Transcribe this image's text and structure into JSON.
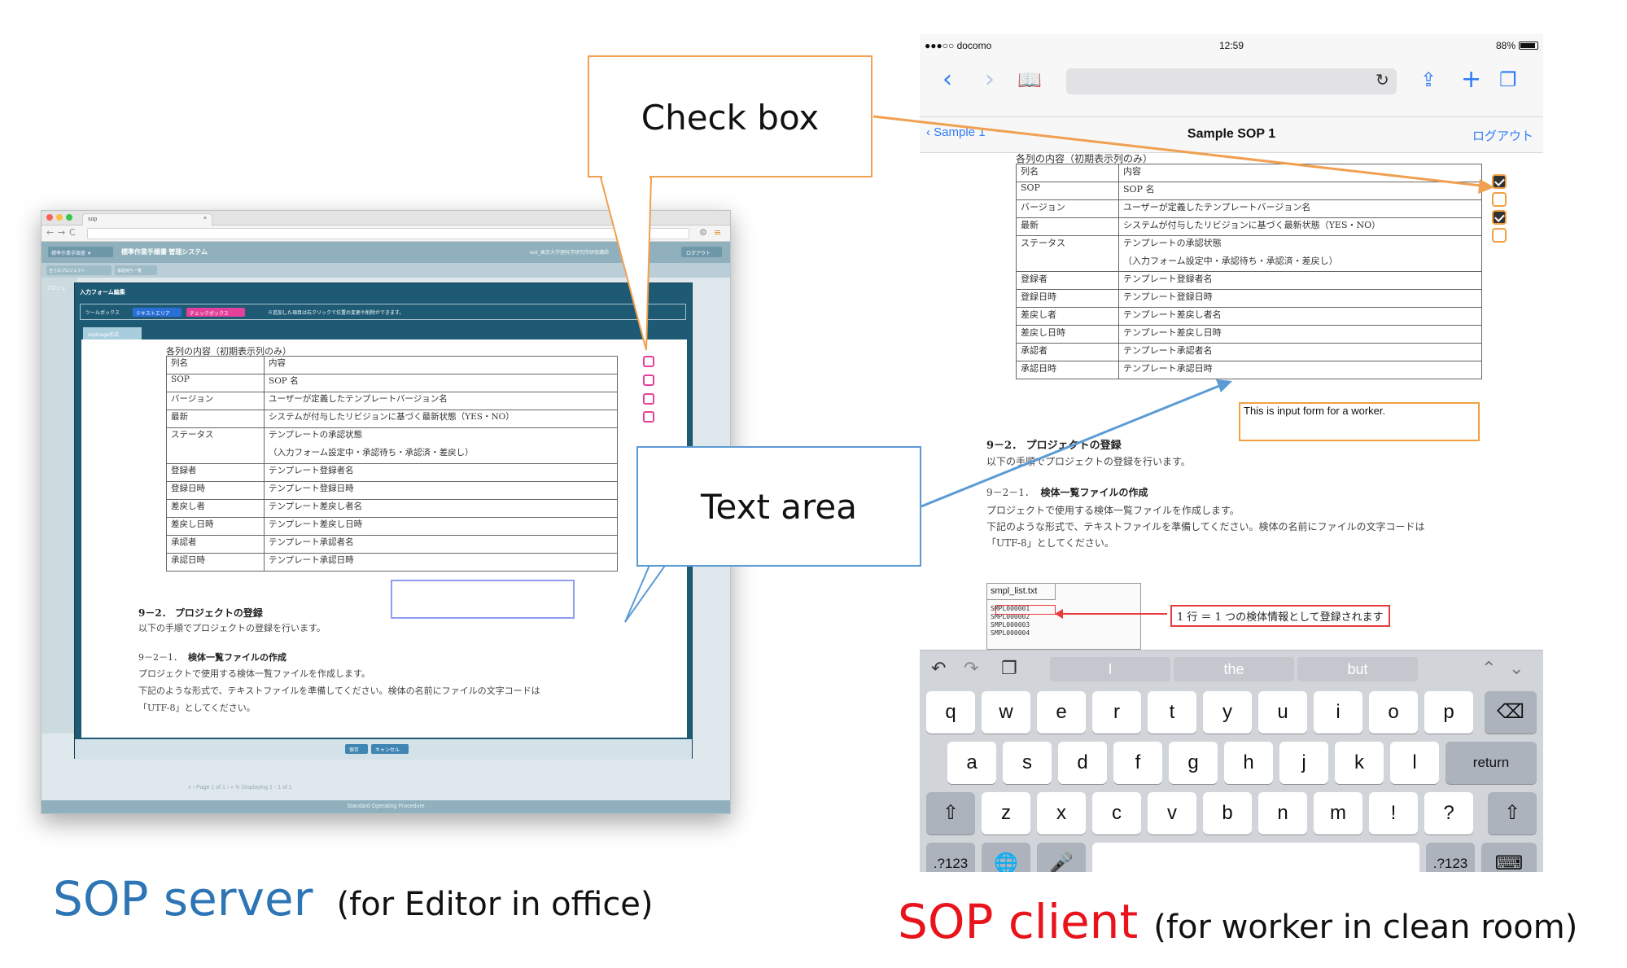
{
  "server": {
    "tab_title": "sop",
    "header_left": "標準作業手順書 ▼",
    "app_title": "標準作業手順書 管理システム",
    "header_user": "test_東京大学理科学研究所研修講師",
    "logout": "ログアウト",
    "subnav": [
      "全てのプロジェクト",
      "承認待ち一覧"
    ],
    "left_label": "プロジェ",
    "modal_title": "入力フォーム編集",
    "toolbox_label": "ツールボックス",
    "tool_buttons": [
      "テキストエリア",
      "チェックボックス"
    ],
    "tool_hint": "※追加した項目は右クリックで位置の変更や削除ができます。",
    "doc_tab": "sopimage形式",
    "footer_buttons": [
      "保存",
      "キャンセル"
    ],
    "pager": "«  ‹  Page  1  of 1  ›  »  ↻   Displaying 1 - 1 of 1",
    "status": "Standard Operating Procedure"
  },
  "sop_doc": {
    "caption": "各列の内容（初期表示列のみ）",
    "rows": [
      [
        "列名",
        "内容"
      ],
      [
        "SOP",
        "SOP 名"
      ],
      [
        "バージョン",
        "ユーザーが定義したテンプレートバージョン名"
      ],
      [
        "最新",
        "システムが付与したリビジョンに基づく最新状態（YES・NO）"
      ],
      [
        "ステータス",
        "テンプレートの承認状態"
      ],
      [
        "",
        "（入力フォーム設定中・承認待ち・承認済・差戻し）"
      ],
      [
        "登録者",
        "テンプレート登録者名"
      ],
      [
        "登録日時",
        "テンプレート登録日時"
      ],
      [
        "差戻し者",
        "テンプレート差戻し者名"
      ],
      [
        "差戻し日時",
        "テンプレート差戻し日時"
      ],
      [
        "承認者",
        "テンプレート承認者名"
      ],
      [
        "承認日時",
        "テンプレート承認日時"
      ]
    ],
    "h_project": "9－2．  プロジェクトの登録",
    "p_project": "以下の手順でプロジェクトの登録を行います。",
    "h_file_num": "9－2－1．",
    "h_file_title": "検体一覧ファイルの作成",
    "p_file1": "プロジェクトで使用する検体一覧ファイルを作成します。",
    "p_file2": "下記のような形式で、テキストファイルを準備してください。検体の名前にファイルの文字コードは",
    "p_file3": "「UTF-8」としてください。"
  },
  "callouts": {
    "checkbox": "Check box",
    "textarea": "Text area"
  },
  "captions": {
    "server_big": "SOP server",
    "server_small": "(for Editor in office)",
    "client_big": "SOP client",
    "client_small": "(for worker in clean room)"
  },
  "client": {
    "carrier": "●●●○○ docomo",
    "time": "12:59",
    "battery": "88%",
    "nav_back": "Sample 1",
    "nav_title": "Sample SOP 1",
    "nav_right": "ログアウト",
    "textarea_value": "This is input form for a worker.",
    "file_tab": "smpl_list.txt",
    "code_lines": [
      "SMPL000001",
      "SMPL000002",
      "SMPL000003",
      "SMPL000004"
    ],
    "annotation": "1 行 ＝ 1 つの検体情報として登録されます",
    "checkboxes": [
      true,
      false,
      true,
      false
    ],
    "suggestions": [
      "I",
      "the",
      "but"
    ],
    "keys_row1": [
      "q",
      "w",
      "e",
      "r",
      "t",
      "y",
      "u",
      "i",
      "o",
      "p"
    ],
    "keys_row2": [
      "a",
      "s",
      "d",
      "f",
      "g",
      "h",
      "j",
      "k",
      "l"
    ],
    "keys_row3": [
      "z",
      "x",
      "c",
      "v",
      "b",
      "n",
      "m",
      "!",
      "?"
    ],
    "return_label": "return",
    "numbers_label": ".?123"
  },
  "colors": {
    "callout_orange": "#f0a050",
    "callout_blue": "#5b9bd5",
    "server_caption": "#2e75b6",
    "client_caption": "#e8131b"
  }
}
